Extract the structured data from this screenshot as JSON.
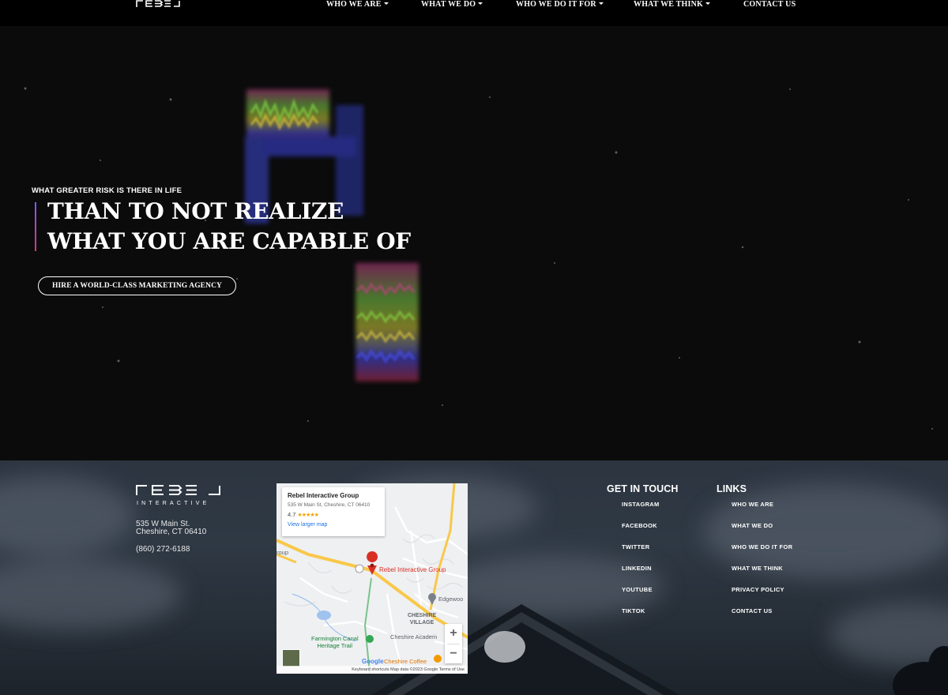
{
  "brand": {
    "logo_text": "REBEL",
    "logo_sub": "INTERACTIVE"
  },
  "nav": {
    "items": [
      {
        "label": "WHO WE ARE",
        "dropdown": true
      },
      {
        "label": "WHAT WE DO",
        "dropdown": true
      },
      {
        "label": "WHO WE DO IT FOR",
        "dropdown": true
      },
      {
        "label": "WHAT WE THINK",
        "dropdown": true
      },
      {
        "label": "CONTACT US",
        "dropdown": false
      }
    ]
  },
  "hero": {
    "kicker": "WHAT GREATER RISK IS THERE IN LIFE",
    "headline_line1": "THAN TO NOT REALIZE",
    "headline_line2": "WHAT YOU ARE CAPABLE OF",
    "cta_label": "HIRE A WORLD-CLASS MARKETING AGENCY"
  },
  "footer": {
    "address_line1": "535 W Main St.",
    "address_line2": "Cheshire, CT 06410",
    "phone": "(860) 272-6188",
    "map": {
      "place_name": "Rebel Interactive Group",
      "place_address": "535 W Main St, Cheshire, CT 06410",
      "rating": "4.7",
      "stars": "★★★★★",
      "larger_map_link": "View larger map",
      "pin_label": "Rebel Interactive Group",
      "labels": {
        "cheshire_village": "CHESHIRE\nVILLAGE",
        "farmington": "Farmington Canal\nHeritage Trail",
        "academy": "Cheshire Academ",
        "edgewood": "Edgewoo",
        "coffee": "Cheshire Coffee",
        "group": "roup"
      },
      "google": "Google",
      "attribution": "Keyboard shortcuts    Map data ©2023 Google    Terms of Use",
      "zoom_in": "+",
      "zoom_out": "−"
    },
    "get_in_touch": {
      "heading": "GET IN TOUCH",
      "links": [
        "INSTAGRAM",
        "FACEBOOK",
        "TWITTER",
        "LINKEDIN",
        "YOUTUBE",
        "TIKTOK"
      ]
    },
    "links": {
      "heading": "LINKS",
      "items": [
        "WHO WE ARE",
        "WHAT WE DO",
        "WHO WE DO IT FOR",
        "WHAT WE THINK",
        "PRIVACY POLICY",
        "CONTACT US"
      ]
    }
  }
}
